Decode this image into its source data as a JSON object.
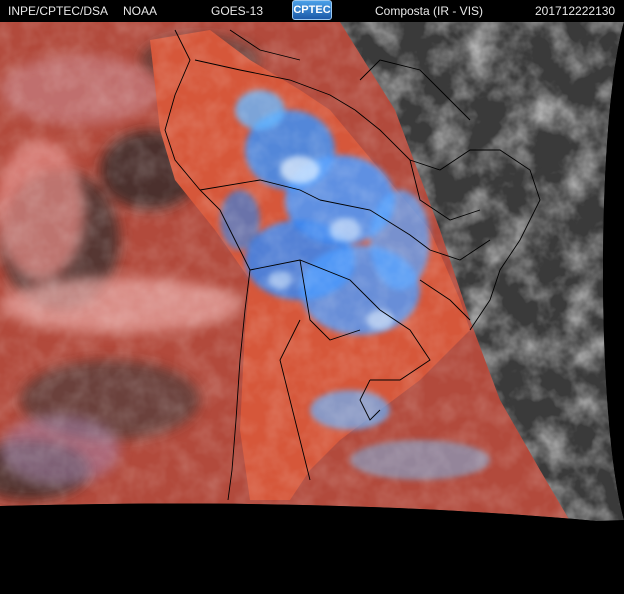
{
  "header": {
    "institution": "INPE/CPTEC/DSA",
    "agency": "NOAA",
    "satellite": "GOES-13",
    "logo_text": "CPTEC",
    "product": "Composta (IR - VIS)",
    "timestamp": "201712222130"
  },
  "colors": {
    "background": "#000000",
    "header_text": "#e8e8e8",
    "warm_surface": "#d9553a",
    "cold_cloud": "#3d8fff",
    "visible_gray": "#7a7a7a",
    "border_lines": "#000000"
  }
}
